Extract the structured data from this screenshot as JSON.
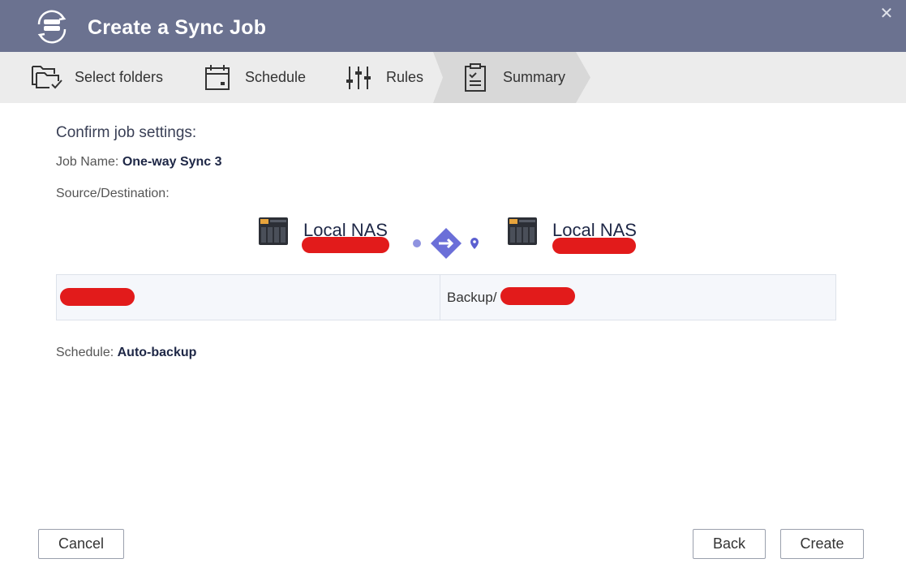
{
  "window": {
    "title": "Create a Sync Job",
    "close_label": "✕"
  },
  "steps": [
    {
      "label": "Select folders"
    },
    {
      "label": "Schedule"
    },
    {
      "label": "Rules"
    },
    {
      "label": "Summary"
    }
  ],
  "summary": {
    "heading": "Confirm job settings:",
    "job_name_label": "Job Name:",
    "job_name_value": "One-way Sync 3",
    "source_dest_label": "Source/Destination:",
    "source_nas": "Local NAS",
    "dest_nas": "Local NAS",
    "destination_path_prefix": "Backup/",
    "schedule_label": "Schedule:",
    "schedule_value": "Auto-backup"
  },
  "buttons": {
    "cancel": "Cancel",
    "back": "Back",
    "create": "Create"
  },
  "colors": {
    "titlebar": "#6b7290",
    "accent": "#6b6fd8",
    "redaction": "#e21b1b"
  }
}
